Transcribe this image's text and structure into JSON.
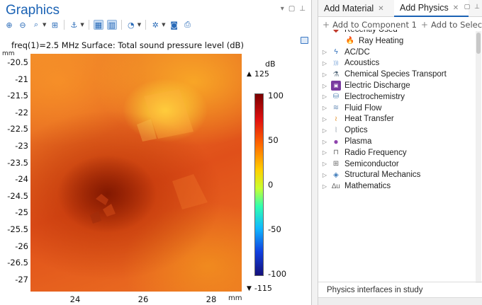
{
  "graphics": {
    "title": "Graphics",
    "plot_header": "freq(1)=2.5 MHz   Surface: Total sound pressure level (dB)",
    "axis_unit_y": "mm",
    "axis_unit_x": "mm",
    "y_ticks": [
      "-20.5",
      "-21",
      "-21.5",
      "-22",
      "-22.5",
      "-23",
      "-23.5",
      "-24",
      "-24.5",
      "-25",
      "-25.5",
      "-26",
      "-26.5",
      "-27"
    ],
    "x_ticks": [
      "24",
      "26",
      "28"
    ],
    "colorbar": {
      "unit": "dB",
      "max_label": "125",
      "min_label": "-115",
      "ticks": [
        "100",
        "50",
        "0",
        "-50",
        "-100"
      ]
    },
    "toolbar_icons": [
      "zoom-in-icon",
      "zoom-out-icon",
      "zoom-box-icon",
      "zoom-extents-icon",
      "transform-icon",
      "select-icon",
      "box-select-icon",
      "scene-light-icon",
      "rotate-icon",
      "camera-icon",
      "print-icon"
    ]
  },
  "right_panel": {
    "tabs": [
      {
        "label": "Add Material",
        "active": false
      },
      {
        "label": "Add Physics",
        "active": true
      }
    ],
    "actions": {
      "add_to_component": "Add to Component 1",
      "add_to_selection": "Add to Selection"
    },
    "tree": [
      {
        "label": "Recently Used",
        "icon": "recent-icon",
        "indent": 0,
        "expandable": false,
        "clipped": true
      },
      {
        "label": "Ray Heating",
        "icon": "ray-heating-icon",
        "indent": 1,
        "expandable": false
      },
      {
        "label": "AC/DC",
        "icon": "acdc-icon",
        "indent": 0,
        "expandable": true
      },
      {
        "label": "Acoustics",
        "icon": "acoustics-icon",
        "indent": 0,
        "expandable": true
      },
      {
        "label": "Chemical Species Transport",
        "icon": "chemical-icon",
        "indent": 0,
        "expandable": true
      },
      {
        "label": "Electric Discharge",
        "icon": "electric-discharge-icon",
        "indent": 0,
        "expandable": true
      },
      {
        "label": "Electrochemistry",
        "icon": "electrochemistry-icon",
        "indent": 0,
        "expandable": true
      },
      {
        "label": "Fluid Flow",
        "icon": "fluid-flow-icon",
        "indent": 0,
        "expandable": true
      },
      {
        "label": "Heat Transfer",
        "icon": "heat-transfer-icon",
        "indent": 0,
        "expandable": true
      },
      {
        "label": "Optics",
        "icon": "optics-icon",
        "indent": 0,
        "expandable": true
      },
      {
        "label": "Plasma",
        "icon": "plasma-icon",
        "indent": 0,
        "expandable": true
      },
      {
        "label": "Radio Frequency",
        "icon": "radio-frequency-icon",
        "indent": 0,
        "expandable": true
      },
      {
        "label": "Semiconductor",
        "icon": "semiconductor-icon",
        "indent": 0,
        "expandable": true
      },
      {
        "label": "Structural Mechanics",
        "icon": "structural-icon",
        "indent": 0,
        "expandable": true
      },
      {
        "label": "Mathematics",
        "icon": "mathematics-icon",
        "indent": 0,
        "expandable": true
      }
    ],
    "footer_section": "Physics interfaces in study"
  },
  "colors": {
    "title_blue": "#1a62b4",
    "active_tab_underline": "#1a62b4"
  }
}
